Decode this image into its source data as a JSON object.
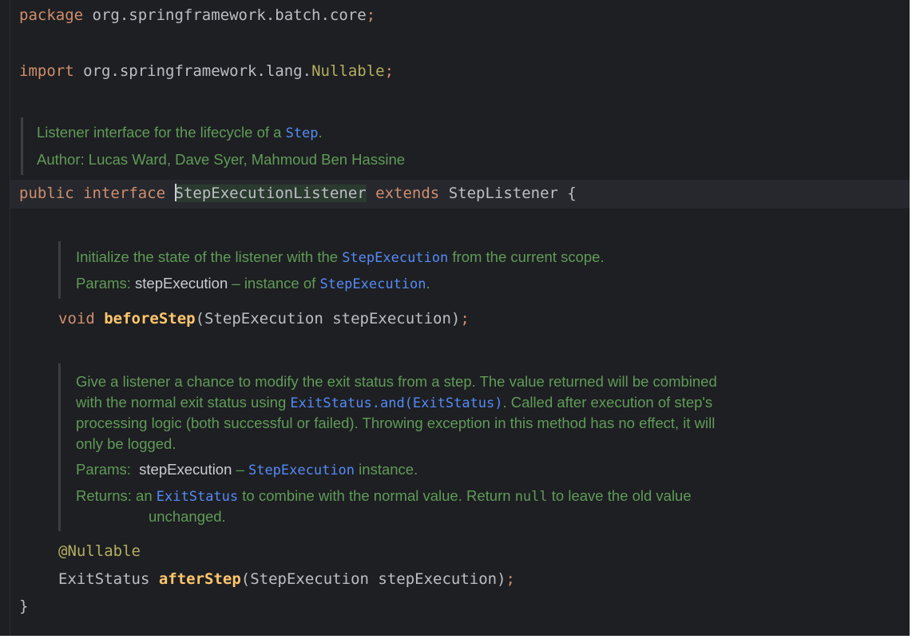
{
  "code": {
    "package_kw": "package",
    "package_name": " org.springframework.batch.core",
    "semicolon": ";",
    "import_kw": "import",
    "import_pkg": " org.springframework.lang.",
    "import_class": "Nullable",
    "public_kw": "public",
    "interface_kw": "interface",
    "interface_name": "StepExecutionListener",
    "extends_kw": "extends",
    "super_name": " StepListener {",
    "void_kw": "void",
    "before_step_name": "beforeStep",
    "before_step_params": "(StepExecution stepExecution)",
    "nullable_annotation": "@Nullable",
    "exit_status_type": "ExitStatus ",
    "after_step_name": "afterStep",
    "after_step_params": "(StepExecution stepExecution)",
    "closing_brace": "}"
  },
  "interface_doc": {
    "line1_text": "Listener interface for the lifecycle of a ",
    "line1_link": "Step",
    "line1_end": ".",
    "author_label": "Author: ",
    "author_names": "Lucas Ward, Dave Syer, Mahmoud Ben Hassine"
  },
  "before_step_doc": {
    "line1_text": "Initialize the state of the listener with the ",
    "line1_link": "StepExecution",
    "line1_end": " from the current scope.",
    "params_label": "Params: ",
    "param_name": "stepExecution",
    "param_desc": " – instance of ",
    "param_link": "StepExecution",
    "param_end": "."
  },
  "after_step_doc": {
    "line1": "Give a listener a chance to modify the exit status from a step. The value returned will be combined",
    "line2_text": "with the normal exit status using ",
    "line2_link": "ExitStatus.and(ExitStatus)",
    "line2_end": ". Called after execution of step's",
    "line3": "processing logic (both successful or failed). Throwing exception in this method has no effect, it will",
    "line4": "only be logged.",
    "params_label": "Params:  ",
    "param_name": "stepExecution",
    "param_desc": " – ",
    "param_link": "StepExecution",
    "param_end": " instance.",
    "returns_label": "Returns: an ",
    "returns_link": "ExitStatus",
    "returns_text": " to combine with the normal value. Return ",
    "returns_null": "null",
    "returns_end": " to leave the old value",
    "returns_cont": "unchanged."
  },
  "colors": {
    "background": "#1e1f22",
    "keyword": "#cf8e6d",
    "doc_comment": "#5f9b58",
    "doc_link": "#548af7",
    "method_name": "#ffc66d",
    "annotation": "#b3ae60",
    "text": "#bcbec4"
  }
}
